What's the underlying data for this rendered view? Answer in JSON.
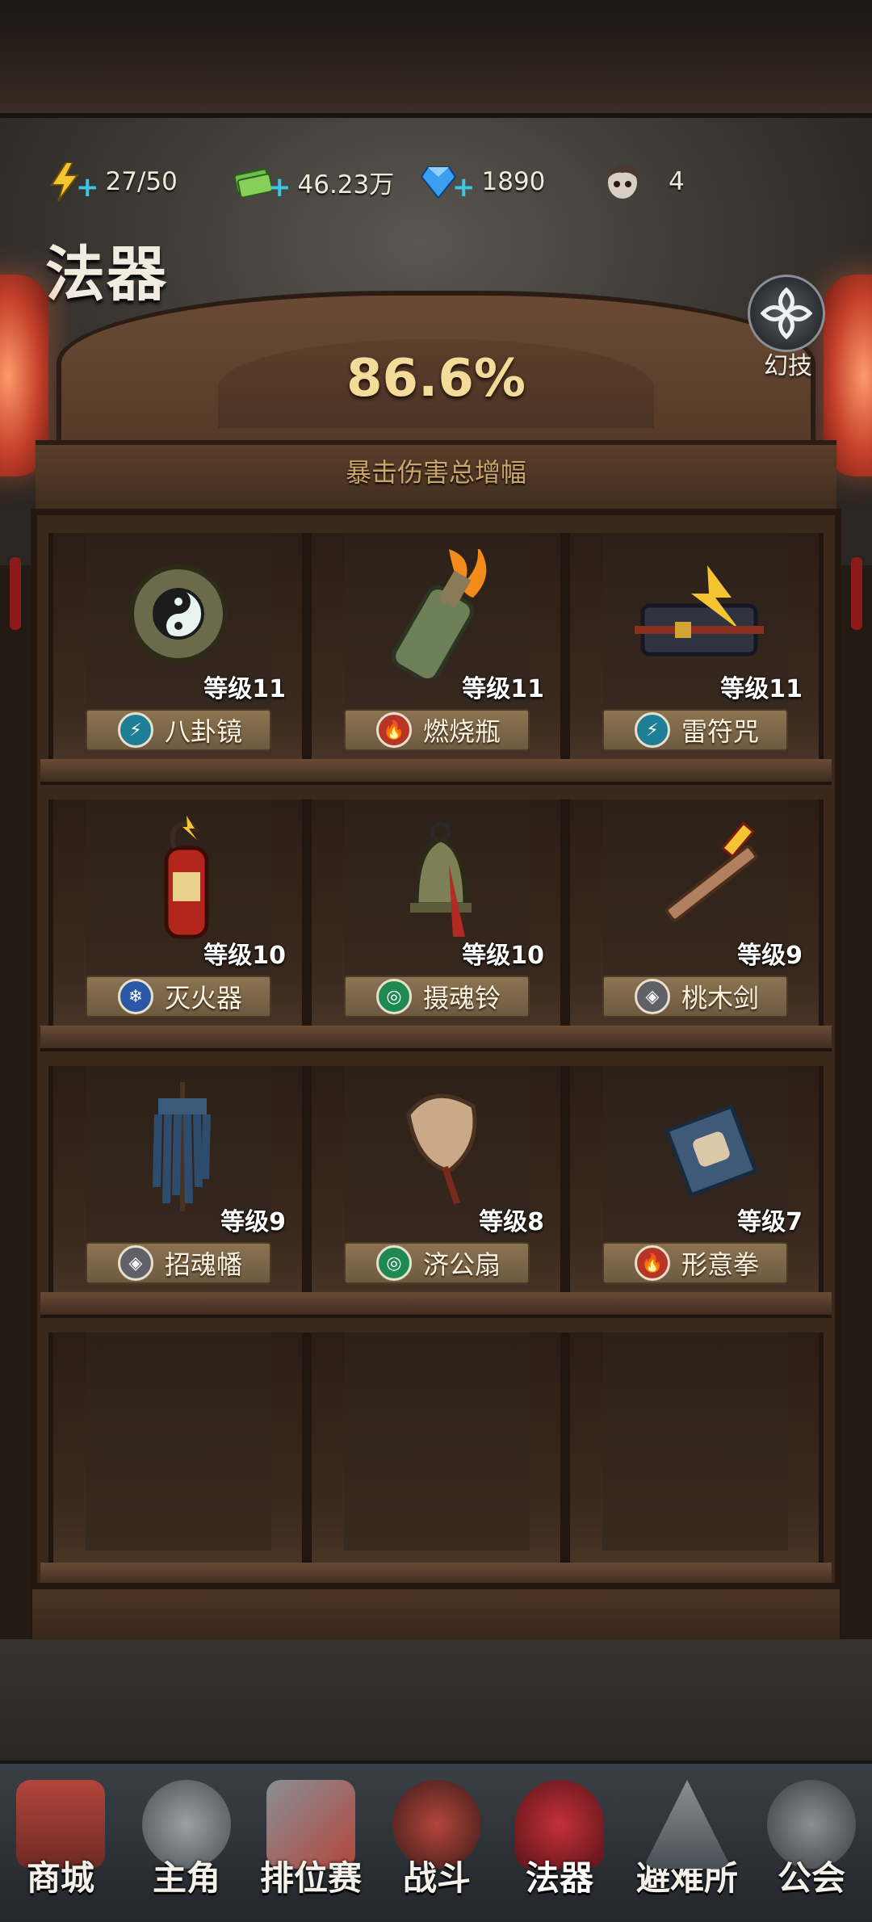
{
  "resources": {
    "energy": "27/50",
    "cash": "46.23万",
    "gems": "1890",
    "survivors": "4"
  },
  "page": {
    "title": "法器",
    "skill_button_label": "幻技"
  },
  "bonus": {
    "value": "86.6%",
    "label": "暴击伤害总增幅"
  },
  "artifacts": [
    {
      "name": "八卦镜",
      "level": "等级11",
      "element": "lightning"
    },
    {
      "name": "燃烧瓶",
      "level": "等级11",
      "element": "fire"
    },
    {
      "name": "雷符咒",
      "level": "等级11",
      "element": "lightning"
    },
    {
      "name": "灭火器",
      "level": "等级10",
      "element": "ice"
    },
    {
      "name": "摄魂铃",
      "level": "等级10",
      "element": "wind"
    },
    {
      "name": "桃木剑",
      "level": "等级9",
      "element": "spirit"
    },
    {
      "name": "招魂幡",
      "level": "等级9",
      "element": "spirit"
    },
    {
      "name": "济公扇",
      "level": "等级8",
      "element": "wind"
    },
    {
      "name": "形意拳",
      "level": "等级7",
      "element": "fire"
    }
  ],
  "nav": [
    {
      "label": "商城",
      "icon": "shop-icon"
    },
    {
      "label": "主角",
      "icon": "hero-icon"
    },
    {
      "label": "排位赛",
      "icon": "ranked-icon"
    },
    {
      "label": "战斗",
      "icon": "battle-icon"
    },
    {
      "label": "法器",
      "icon": "artifact-bell-icon",
      "active": true
    },
    {
      "label": "避难所",
      "icon": "shelter-icon"
    },
    {
      "label": "公会",
      "icon": "guild-icon"
    }
  ],
  "colors": {
    "gold_text": "#f3dc9a",
    "plus_accent": "#3bc6e3",
    "lightning": "#1e7f94",
    "fire": "#b63525",
    "ice": "#2a57a6",
    "wind": "#1e8a52",
    "spirit": "#606068"
  }
}
